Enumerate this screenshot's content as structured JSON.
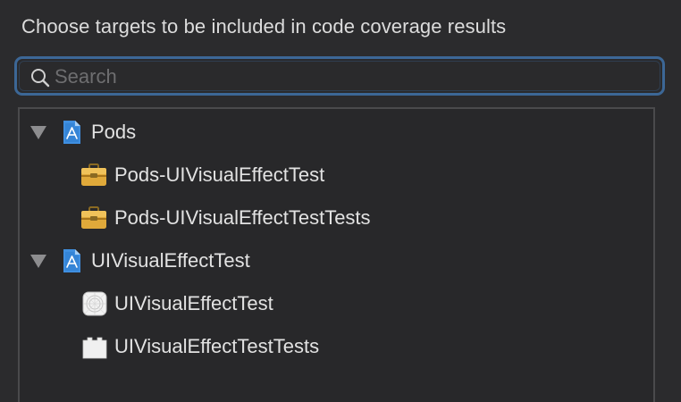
{
  "header": {
    "title": "Choose targets to be included in code coverage results"
  },
  "search": {
    "placeholder": "Search",
    "value": ""
  },
  "tree": {
    "groups": [
      {
        "label": "Pods",
        "icon": "xcode-project-icon",
        "expanded": true,
        "items": [
          {
            "label": "Pods-UIVisualEffectTest",
            "icon": "framework-toolbox-icon"
          },
          {
            "label": "Pods-UIVisualEffectTestTests",
            "icon": "framework-toolbox-icon"
          }
        ]
      },
      {
        "label": "UIVisualEffectTest",
        "icon": "xcode-project-icon",
        "expanded": true,
        "items": [
          {
            "label": "UIVisualEffectTest",
            "icon": "app-target-icon"
          },
          {
            "label": "UIVisualEffectTestTests",
            "icon": "test-bundle-icon"
          }
        ]
      }
    ]
  },
  "colors": {
    "background": "#2b2b2d",
    "focus_ring": "#3c6796",
    "text": "#e2e2e2",
    "toolbox": "#e0a93a"
  }
}
